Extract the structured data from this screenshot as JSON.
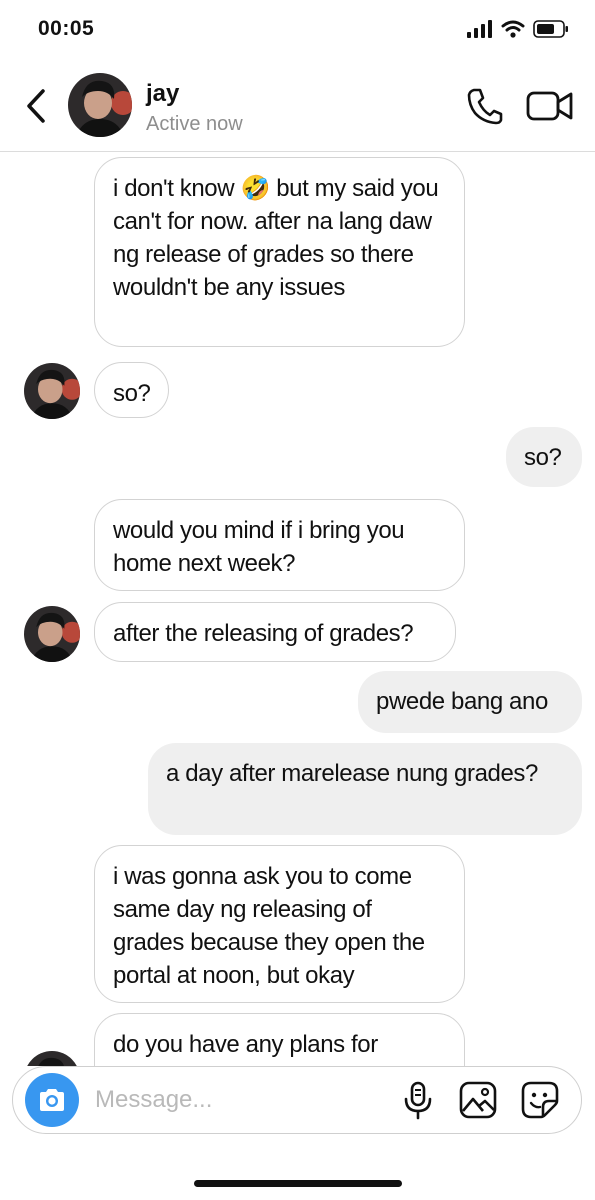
{
  "status_bar": {
    "time": "00:05"
  },
  "header": {
    "contact_name": "jay",
    "contact_status": "Active now"
  },
  "messages": [
    {
      "direction": "incoming",
      "text": "i don't know 🤣 but my said you can't for now. after na lang daw ng release of grades so there wouldn't be any issues"
    },
    {
      "direction": "incoming",
      "text": "so?"
    },
    {
      "direction": "outgoing",
      "text": "so?"
    },
    {
      "direction": "incoming",
      "text": "would you mind if i bring you home next week?"
    },
    {
      "direction": "incoming",
      "text": "after the releasing of grades?"
    },
    {
      "direction": "outgoing",
      "text": "pwede bang ano"
    },
    {
      "direction": "outgoing",
      "text": "a day after marelease nung grades?"
    },
    {
      "direction": "incoming",
      "text": "i was gonna ask you to come same day ng releasing of grades because they open the portal at noon, but okay"
    },
    {
      "direction": "incoming",
      "text": "do you have any plans for"
    }
  ],
  "composer": {
    "placeholder": "Message..."
  },
  "colors": {
    "accent": "#3897f0",
    "incoming_border": "#d3d3d3",
    "outgoing_bg": "#efefef"
  },
  "icons": [
    "back-icon",
    "phone-icon",
    "video-icon",
    "camera-icon",
    "mic-icon",
    "gallery-icon",
    "sticker-icon",
    "signal-icon",
    "wifi-icon",
    "battery-icon"
  ]
}
